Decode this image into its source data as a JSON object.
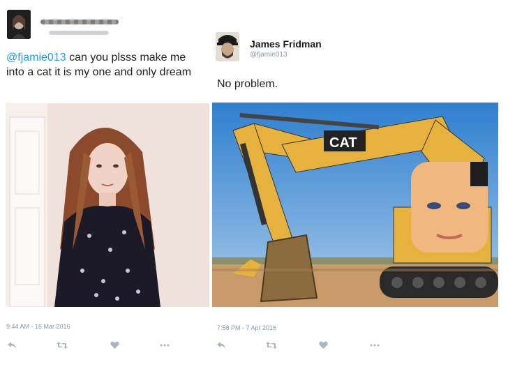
{
  "left_tweet": {
    "mention": "@fjamie013",
    "text": " can you plsss make me into a cat it is my one and only dream",
    "timestamp": "9:44 AM - 16 Mar 2016"
  },
  "right_tweet": {
    "name": "James Fridman",
    "handle": "@fjamie013",
    "text": "No problem.",
    "timestamp": "7:58 PM - 7 Apr 2016",
    "image_logo_text": "CAT"
  },
  "icons": {
    "reply": "reply-icon",
    "retweet": "retweet-icon",
    "like": "heart-icon",
    "more": "more-icon"
  },
  "colors": {
    "mention": "#1da1f2",
    "meta": "#8899a6",
    "action": "#a9b5bf",
    "sky": "#3f8ad1",
    "excavator": "#e6b23d"
  }
}
